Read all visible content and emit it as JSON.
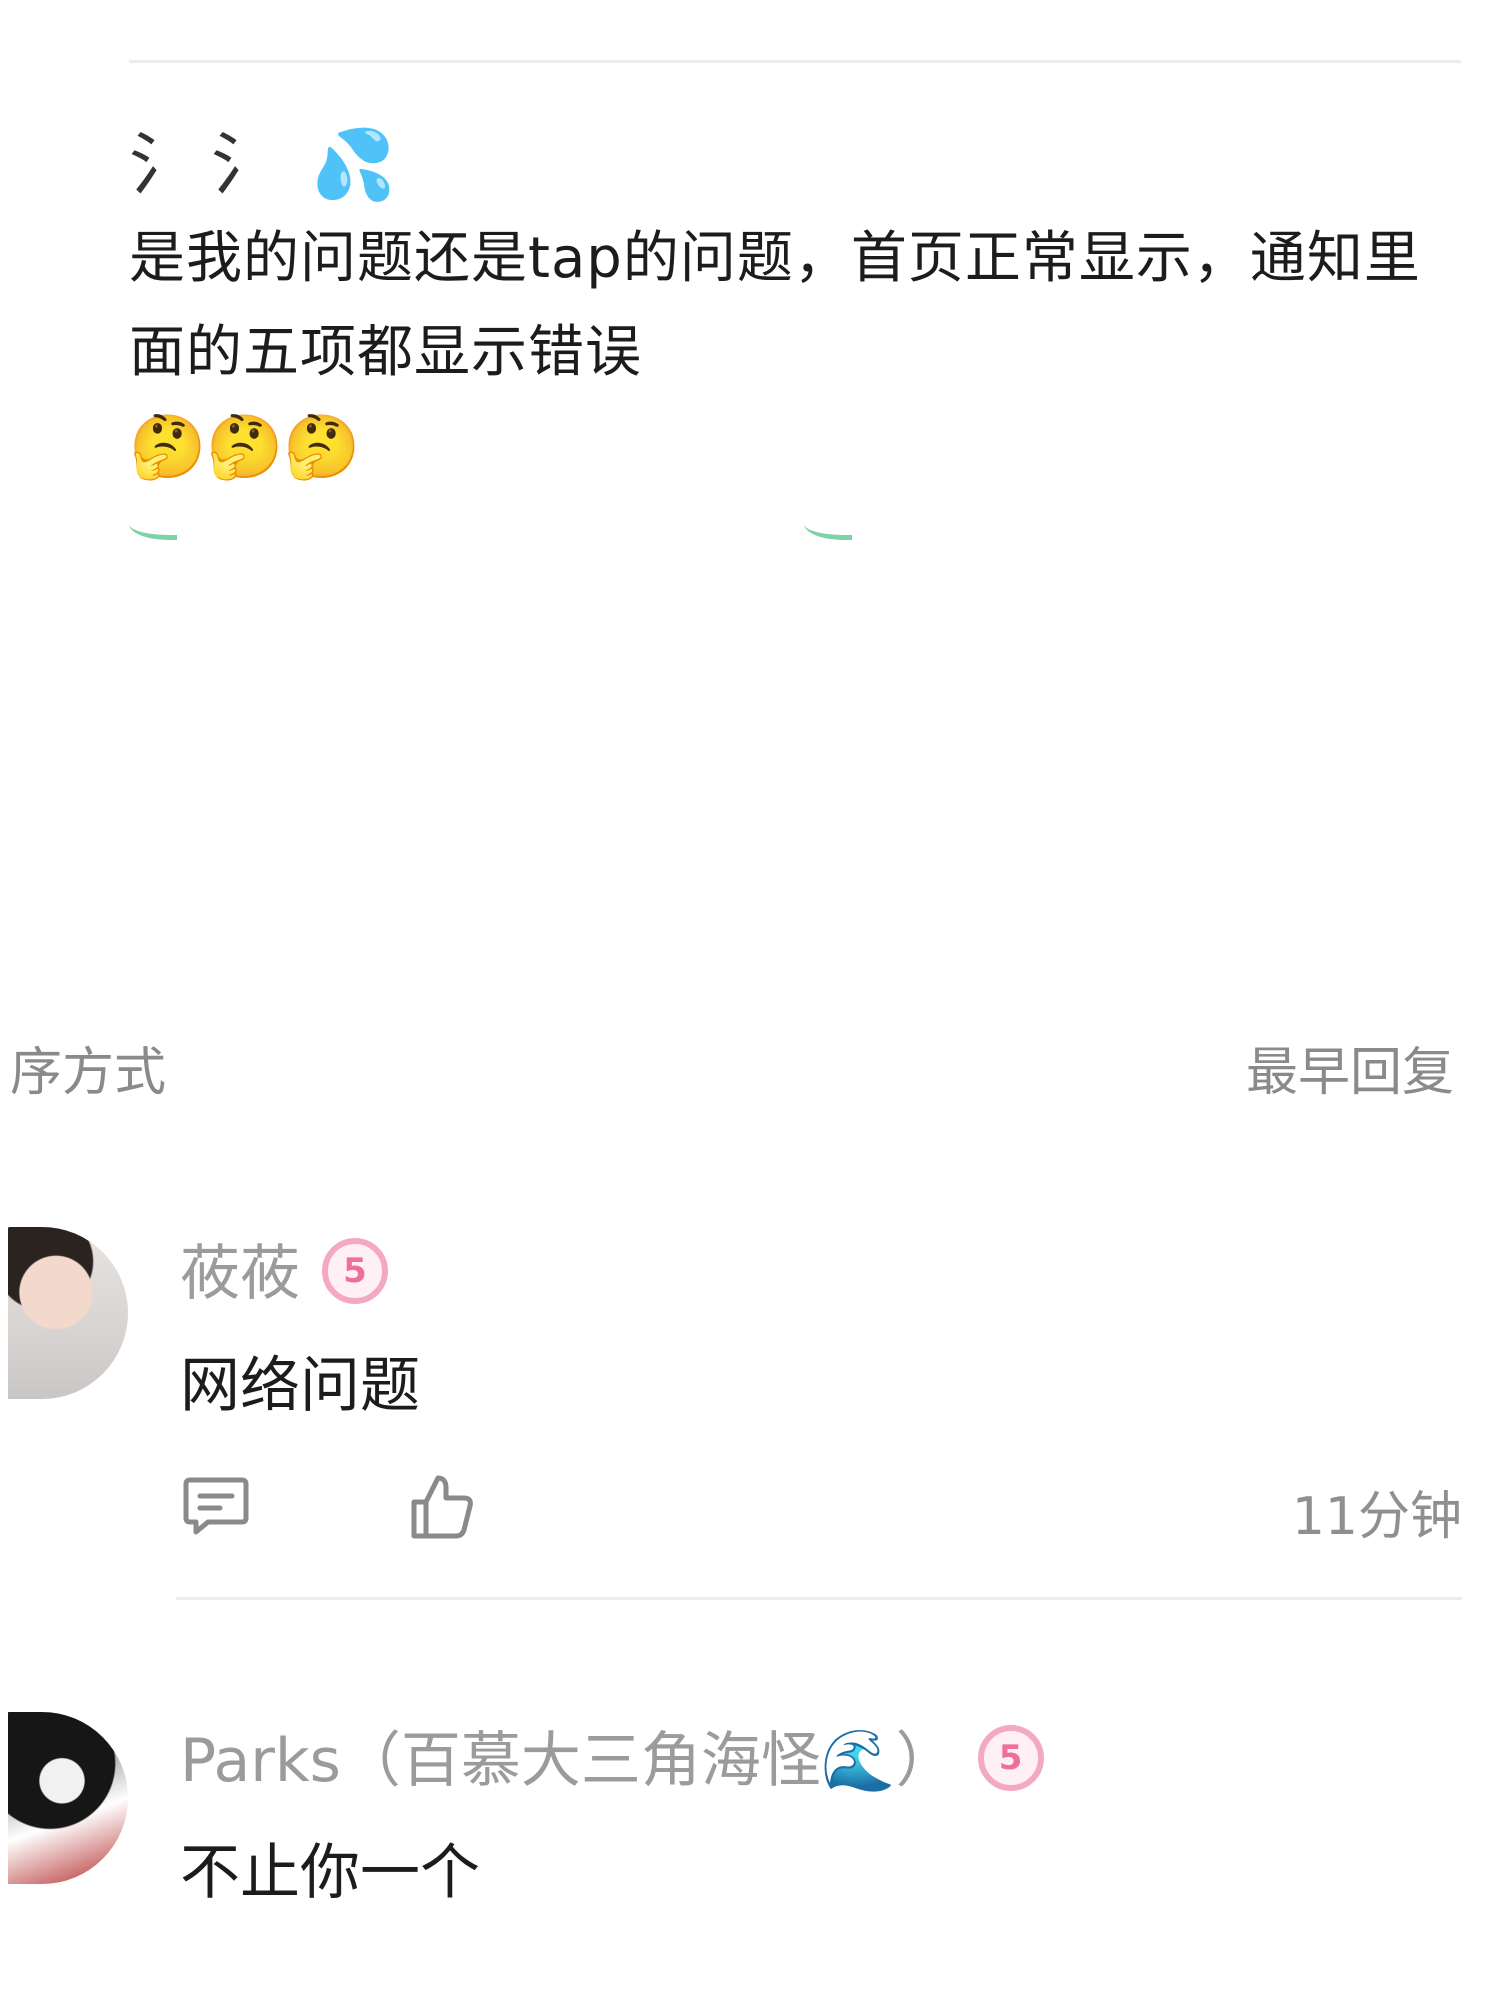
{
  "post": {
    "drip_glyph": "氵氵",
    "sweat_emoji": "💦",
    "text": "是我的问题还是tap的问题，首页正常显示，通知里面的五项都显示错误",
    "think_emojis": "🤔🤔🤔"
  },
  "sort": {
    "label": "序方式",
    "value": "最早回复"
  },
  "comments": [
    {
      "username": "莜莜",
      "badge": "5",
      "text": "网络问题",
      "time": "11分钟"
    },
    {
      "username": "Parks（百慕大三角海怪🌊）",
      "badge": "5",
      "text": "不止你一个"
    }
  ],
  "colors": {
    "badge_pink": "#ee6f9a",
    "muted_gray": "#8a8a8a",
    "divider": "#ececec"
  }
}
